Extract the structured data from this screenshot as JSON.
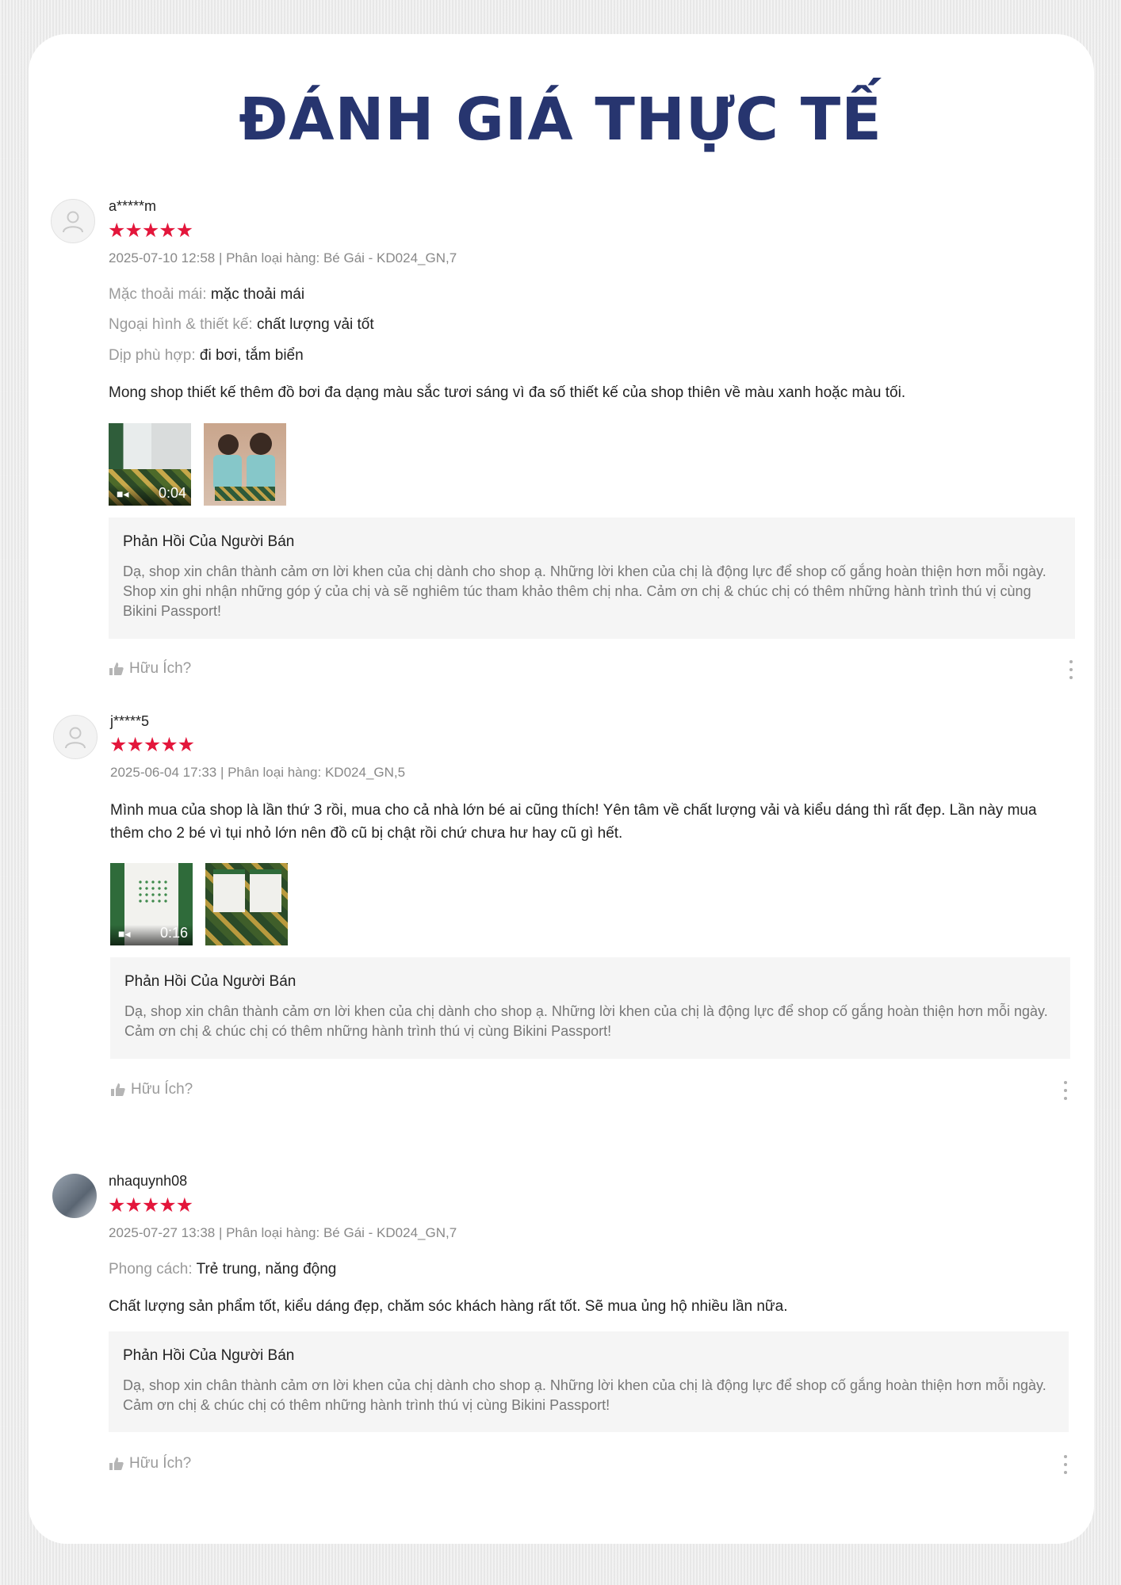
{
  "title": "ĐÁNH GIÁ THỰC TẾ",
  "reviews": [
    {
      "username": "a*****m",
      "stars": "★★★★★",
      "rating": 5,
      "meta": "2025-07-10 12:58 | Phân loại hàng: Bé Gái - KD024_GN,7",
      "attributes": [
        {
          "key": "Mặc thoải mái:",
          "value": "mặc thoải mái"
        },
        {
          "key": "Ngoại hình & thiết kế:",
          "value": "chất lượng vải tốt"
        },
        {
          "key": "Dịp phù hợp:",
          "value": "đi bơi, tắm biển"
        }
      ],
      "comment": "Mong shop thiết kế thêm đồ bơi đa dạng màu sắc tươi sáng vì đa số thiết kế của shop thiên về màu xanh hoặc màu tối.",
      "video_duration": "0:04",
      "reply_title": "Phản Hồi Của Người Bán",
      "reply_text": "Dạ, shop xin chân thành cảm ơn lời khen của chị dành cho shop ạ. Những lời khen của chị là động lực để shop cố gắng hoàn thiện hơn mỗi ngày. Shop xin ghi nhận những góp ý của chị và sẽ nghiêm túc tham khảo thêm chị nha. Cảm ơn chị & chúc chị có thêm những hành trình thú vị cùng Bikini Passport!",
      "helpful": "Hữu Ích?"
    },
    {
      "username": "j*****5",
      "stars": "★★★★★",
      "rating": 5,
      "meta": "2025-06-04 17:33 | Phân loại hàng: KD024_GN,5",
      "comment": "Mình mua của shop là lần thứ 3 rồi, mua cho cả nhà lớn bé ai cũng thích! Yên tâm về chất lượng vải và kiểu dáng thì rất đẹp. Lần này mua thêm cho 2 bé vì tụi nhỏ lớn nên đồ cũ bị chật rồi chứ chưa hư hay cũ gì hết.",
      "video_duration": "0:16",
      "reply_title": "Phản Hồi Của Người Bán",
      "reply_text": "Dạ, shop xin chân thành cảm ơn lời khen của chị dành cho shop ạ. Những lời khen của chị là động lực để shop cố gắng hoàn thiện hơn mỗi ngày. Cảm ơn chị & chúc chị có thêm những hành trình thú vị cùng Bikini Passport!",
      "helpful": "Hữu Ích?"
    },
    {
      "username": "nhaquynh08",
      "stars": "★★★★★",
      "rating": 5,
      "meta": "2025-07-27 13:38 | Phân loại hàng: Bé Gái - KD024_GN,7",
      "attributes": [
        {
          "key": "Phong cách:",
          "value": "Trẻ trung, năng động"
        }
      ],
      "comment": "Chất lượng sản phẩm tốt, kiểu dáng đẹp, chăm sóc khách hàng rất tốt. Sẽ mua ủng hộ nhiều lần nữa.",
      "reply_title": "Phản Hồi Của Người Bán",
      "reply_text": "Dạ, shop xin chân thành cảm ơn lời khen của chị dành cho shop ạ. Những lời khen của chị là động lực để shop cố gắng hoàn thiện hơn mỗi ngày. Cảm ơn chị & chúc chị có thêm những hành trình thú vị cùng Bikini Passport!",
      "helpful": "Hữu Ích?"
    }
  ],
  "colors": {
    "title": "#27356f",
    "star": "#e3163b",
    "reply_bg": "#f5f5f5"
  }
}
